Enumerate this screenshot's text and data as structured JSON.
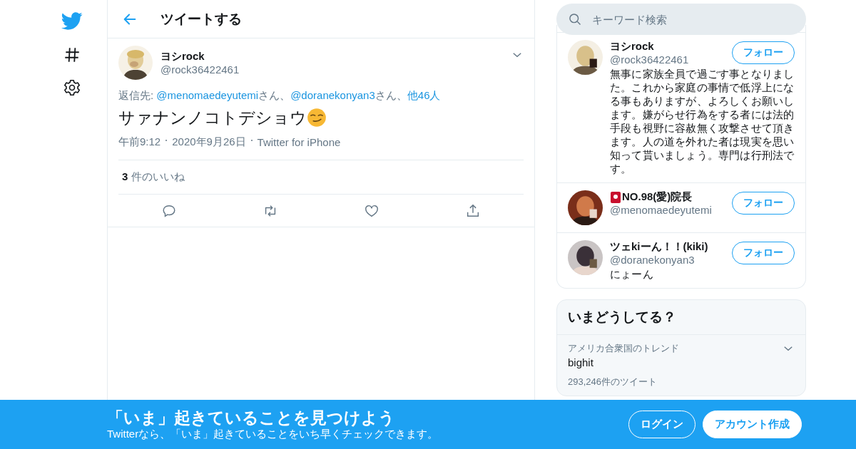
{
  "header": {
    "title": "ツイートする"
  },
  "tweet": {
    "name": "ヨシrock",
    "handle": "@rock36422461",
    "reply_to": [
      {
        "kind": "text",
        "text": "返信先: "
      },
      {
        "kind": "link",
        "text": "@menomaedeyutemi"
      },
      {
        "kind": "text",
        "text": "さん、"
      },
      {
        "kind": "link",
        "text": "@doranekonyan3"
      },
      {
        "kind": "text",
        "text": "さん、"
      },
      {
        "kind": "link",
        "text": "他46人"
      }
    ],
    "text": "サァナンノコトデショウ",
    "meta": [
      "午前9:12",
      "2020年9月26日",
      "Twitter for iPhone"
    ],
    "likes": "**3** 件のいいね"
  },
  "search": {
    "placeholder": "キーワード検索"
  },
  "users": [
    {
      "name": "ヨシrock",
      "badge": false,
      "handle": "@rock36422461",
      "bio": "無事に家族全員で過ごす事となりました。これから家庭の事情で低浮上になる事もありますが、よろしくお願いします。嫌がらせ行為をする者には法的手段も視野に容赦無く攻撃させて頂きます。人の道を外れた者は現実を思い知って貰いましょう。専門は行刑法です。",
      "button": "フォロー"
    },
    {
      "name": "NO.98(愛)院長",
      "badge": true,
      "handle": "@menomaedeyutemi",
      "button": "フォロー"
    },
    {
      "name": "ツェkiーん！！(kiki)",
      "badge": false,
      "handle": "@doranekonyan3",
      "bio": "にょーん",
      "button": "フォロー"
    }
  ],
  "trends": {
    "title": "いまどうしてる？",
    "items": [
      {
        "context": "アメリカ合衆国のトレンド",
        "name": "bighit",
        "count": "293,246件のツイート"
      }
    ]
  },
  "banner": {
    "title": "「いま」起きていることを見つけよう",
    "subtitle": "Twitterなら、「いま」起きていることをいち早くチェックできます。",
    "login": "ログイン",
    "signup": "アカウント作成"
  }
}
